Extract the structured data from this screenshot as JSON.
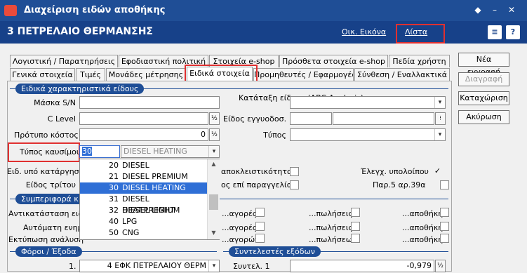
{
  "window": {
    "title": "Διαχείριση ειδών αποθήκης"
  },
  "header": {
    "record_title": "3 ΠΕΤΡΕΛΑΙΟ ΘΕΡΜΑΝΣΗΣ",
    "image_link": "Οικ. Εικόνα",
    "list_link": "Λίστα"
  },
  "tabs_row1": [
    "Λογιστική / Παρατηρήσεις",
    "Εφοδιαστική πολιτική",
    "Στοιχεία e-shop",
    "Πρόσθετα στοιχεία e-shop",
    "Πεδία χρήστη"
  ],
  "tabs_row2": [
    "Γενικά στοιχεία",
    "Τιμές",
    "Μονάδες μέτρησης",
    "Ειδικά στοιχεία",
    "Προμηθευτές / Εφαρμογές",
    "Σύνθεση / Εναλλακτικά"
  ],
  "actions": {
    "new": "Νέα εγγραφή",
    "delete": "Διαγραφή",
    "save": "Καταχώριση",
    "cancel": "Ακύρωση"
  },
  "special": {
    "group_title": "Ειδικά χαρακτηριστικά είδους",
    "mask_label": "Μάσκα S/N",
    "clevel_label": "C Level",
    "std_cost_label": "Πρότυπο κόστος",
    "std_cost_value": "0",
    "abc_label": "Κατάταξη είδους (ABC Analysis)",
    "guarantee_label": "Είδος εγγυοδοσ.",
    "type_label": "Τύπος",
    "fuel_label": "Τύπος καυσίμου",
    "fuel_code": "30",
    "fuel_name": "DIESEL HEATING",
    "contract_label": "Ειδ. υπό κατάργηση",
    "third_label": "Είδος τρίτου",
    "exclusive_label": "αποκλειστικότητας",
    "order_label": "ος επί παραγγελία",
    "balance_check_label": "Έλεγχ. υπολοίπου",
    "balance_check_mark": "✓",
    "par5_label": "Παρ.5 αρ.39α"
  },
  "fuel_options": [
    {
      "code": "20",
      "name": "DIESEL"
    },
    {
      "code": "21",
      "name": "DIESEL PREMIUM"
    },
    {
      "code": "30",
      "name": "DIESEL HEATING"
    },
    {
      "code": "31",
      "name": "DIESEL HEAT.PREMIUM"
    },
    {
      "code": "32",
      "name": "DIESEL LIGHT"
    },
    {
      "code": "40",
      "name": "LPG"
    },
    {
      "code": "50",
      "name": "CNG"
    }
  ],
  "completion": {
    "group_title": "Συμπεριφορά κ",
    "replace_label": "Αντικατάσταση ειδ",
    "auto_label": "Αυτόματη ενημ",
    "print_label": "Εκτύπωση ανάλυση",
    "purchases1": "...αγορές",
    "sales1": "...πωλήσεις",
    "warehouse1": "...αποθήκη",
    "purchases2": "...αγορές",
    "sales2": "...πωλήσεις",
    "warehouse2": "...αποθήκη",
    "purchases3": "...αγορών",
    "sales3": "...πωλήσεων",
    "warehouse3": "...αποθήκη"
  },
  "taxes": {
    "group_title": "Φόροι / Έξοδα",
    "row_label": "1.",
    "row_value": "4 ΕΦΚ ΠΕΤΡΕΛΑΙΟΥ ΘΕΡΜ",
    "coef_group_title": "Συντελεστές εξόδων",
    "coef_label": "Συντελ. 1",
    "coef_value": "-0,979"
  },
  "symbols": {
    "half": "½",
    "dropdown": "▾"
  }
}
